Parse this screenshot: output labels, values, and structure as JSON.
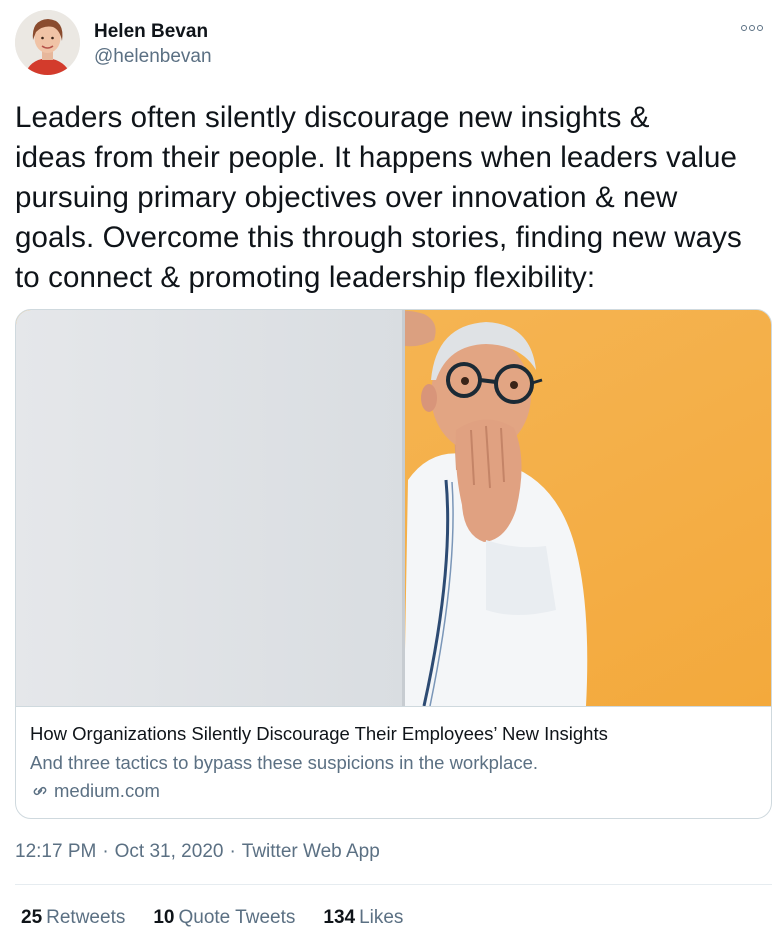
{
  "author": {
    "name": "Helen Bevan",
    "handle": "@helenbevan"
  },
  "more_icon": "more-horizontal-icon",
  "tweet": {
    "text": "Leaders often silently discourage new insights &\nideas from their people. It happens when leaders value\npursuing primary objectives over innovation & new\ngoals. Overcome this through stories, finding new ways\nto connect & promoting leadership flexibility:"
  },
  "card": {
    "title": "How Organizations Silently Discourage Their Employees’ New Insights",
    "description": "And three tactics to bypass these suspicions in the workplace.",
    "domain": "medium.com",
    "domain_icon": "link-icon"
  },
  "meta": {
    "time": "12:17 PM",
    "sep1": "·",
    "date": "Oct 31, 2020",
    "sep2": "·",
    "app": "Twitter Web App"
  },
  "stats": {
    "retweets_count": "25",
    "retweets_label": "Retweets",
    "quotes_count": "10",
    "quotes_label": "Quote Tweets",
    "likes_count": "134",
    "likes_label": "Likes"
  },
  "colors": {
    "text": "#0f1419",
    "secondary": "#5b7083",
    "border": "#cfd9de",
    "image_background": "#f5b24b"
  }
}
